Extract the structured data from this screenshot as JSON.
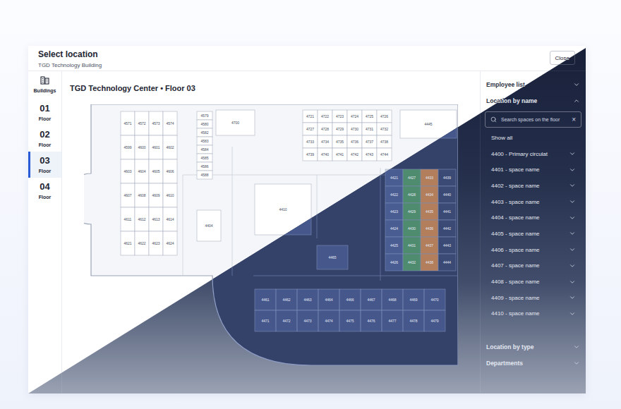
{
  "header": {
    "title": "Select location",
    "subtitle": "TGD Technology Building",
    "close_button": "Close"
  },
  "nav": {
    "buildings_label": "Buildings",
    "floors": [
      {
        "number": "01",
        "label": "Floor",
        "selected": false
      },
      {
        "number": "02",
        "label": "Floor",
        "selected": false
      },
      {
        "number": "03",
        "label": "Floor",
        "selected": true
      },
      {
        "number": "04",
        "label": "Floor",
        "selected": false
      }
    ]
  },
  "floor_plan": {
    "title": "TGD  Technology Center • Floor 03",
    "blocks": [
      {
        "rooms": [
          "4571",
          "4572",
          "4573",
          "4574",
          "4599",
          "4600",
          "4601",
          "4602",
          "4603",
          "4604",
          "4605",
          "4606",
          "4607",
          "4608",
          "4609",
          "4610",
          "4611",
          "4612",
          "4613",
          "4614",
          "4621",
          "4622",
          "4623",
          "4624"
        ]
      },
      {
        "rooms": [
          "4579",
          "4580",
          "4582",
          "4583",
          "4584",
          "4585",
          "4586",
          "4588"
        ]
      },
      {
        "rooms": [
          "4721",
          "4722",
          "4723",
          "4724",
          "4725",
          "4726",
          "4727",
          "4728",
          "4729",
          "4730",
          "4731",
          "4732",
          "4733",
          "4734",
          "4735",
          "4736",
          "4737",
          "4738",
          "4739",
          "4740",
          "4741",
          "4742",
          "4743",
          "4744"
        ]
      },
      {
        "rooms": [
          "4461",
          "4462",
          "4463",
          "4464",
          "4466",
          "4467",
          "4468",
          "4469",
          "4470",
          "4471",
          "4472",
          "4473",
          "4474",
          "4475",
          "4476",
          "4477",
          "4478",
          "4479"
        ]
      }
    ],
    "zones": [
      {
        "color": "#4a5d93",
        "rooms": [
          "4421",
          "4422",
          "4423",
          "4424",
          "4425",
          "4426"
        ]
      },
      {
        "color": "#4f8b6e",
        "rooms": [
          "4427",
          "4428",
          "4429",
          "4430",
          "4431",
          "4432"
        ]
      },
      {
        "color": "#b27e5b",
        "rooms": [
          "4433",
          "4434",
          "4435",
          "4436",
          "4437",
          "4438"
        ]
      },
      {
        "color": "#3b4a74",
        "rooms": [
          "4439",
          "4440",
          "4441",
          "4442",
          "4443",
          "4444"
        ]
      }
    ],
    "rooms": [
      "4700",
      "4410",
      "4445",
      "4404",
      "4465"
    ]
  },
  "panel": {
    "sections": [
      {
        "label": "Employee list",
        "expanded": false
      },
      {
        "label": "Location by name",
        "expanded": true
      },
      {
        "label": "Location by type",
        "expanded": false
      },
      {
        "label": "Departments",
        "expanded": false
      }
    ],
    "search": {
      "placeholder": "Search spaces on the floor",
      "clear": "×"
    },
    "items": [
      {
        "label": "Show all",
        "expandable": false
      },
      {
        "label": "4400 - Primary circulat",
        "expandable": true
      },
      {
        "label": "4401 - space name",
        "expandable": true
      },
      {
        "label": "4402 -  space name",
        "expandable": true
      },
      {
        "label": "4403 - space name",
        "expandable": true
      },
      {
        "label": "4404 - space name",
        "expandable": true
      },
      {
        "label": "4405 - space name",
        "expandable": true
      },
      {
        "label": "4406 - space name",
        "expandable": true
      },
      {
        "label": "4407 - space name",
        "expandable": true
      },
      {
        "label": "4408 - space name",
        "expandable": true
      },
      {
        "label": "4409 - space name",
        "expandable": true
      },
      {
        "label": "4410 - space name",
        "expandable": true
      }
    ]
  }
}
